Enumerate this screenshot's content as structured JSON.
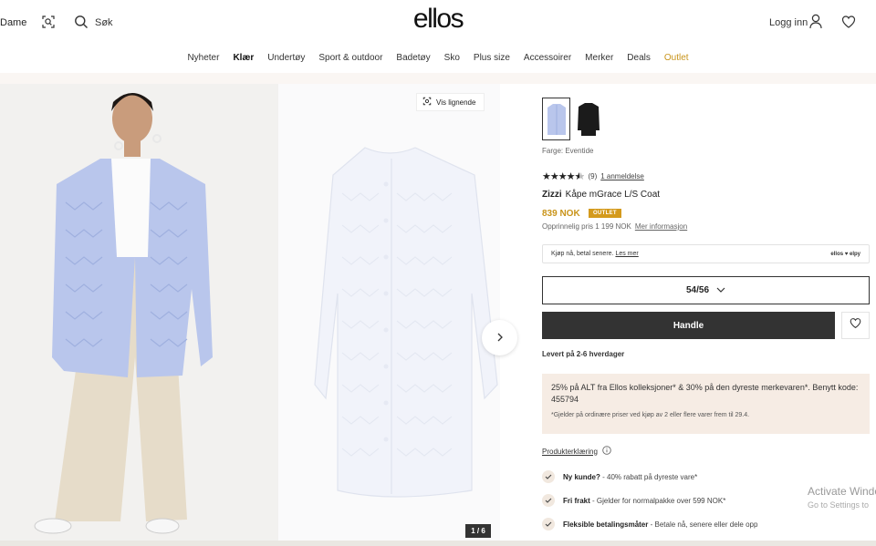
{
  "header": {
    "department": "Dame",
    "search_label": "Søk",
    "logo": "ellos",
    "login_label": "Logg inn",
    "icons": [
      "camera-search-icon",
      "search-icon",
      "user-icon",
      "heart-icon"
    ]
  },
  "nav": {
    "items": [
      {
        "label": "Nyheter"
      },
      {
        "label": "Klær"
      },
      {
        "label": "Undertøy"
      },
      {
        "label": "Sport & outdoor"
      },
      {
        "label": "Badetøy"
      },
      {
        "label": "Sko"
      },
      {
        "label": "Plus size"
      },
      {
        "label": "Accessoirer"
      },
      {
        "label": "Merker"
      },
      {
        "label": "Deals"
      },
      {
        "label": "Outlet"
      }
    ],
    "active": "Klær",
    "outlet_color": "#c9941a"
  },
  "gallery": {
    "similar_label": "Vis lignende",
    "counter": "1 / 6"
  },
  "product": {
    "color_label": "Farge: Eventide",
    "rating": {
      "stars": 4.5,
      "count": "(9)",
      "reviews_link": "1 anmeldelse"
    },
    "brand": "Zizzi",
    "name": "Kåpe mGrace L/S Coat",
    "price": "839 NOK",
    "badge": "OUTLET",
    "original_price": "Opprinnelig pris 1 199 NOK",
    "more_info": "Mer informasjon",
    "swatches": [
      {
        "color": "#b9c6ec",
        "name": "Eventide"
      },
      {
        "color": "#1b1b1b",
        "name": "Black"
      }
    ]
  },
  "klarna": {
    "text": "Kjøp nå, betal senere.",
    "link": "Les mer",
    "brand": "ellos ♥ elpy"
  },
  "purchase": {
    "size": "54/56",
    "buy_label": "Handle",
    "delivery": "Levert på 2-6 hverdager"
  },
  "promo": {
    "text": "25% på ALT fra Ellos kolleksjoner* & 30% på den dyreste merkevaren*. Benytt kode: 455794",
    "note": "*Gjelder på ordinære priser ved kjøp av 2 eller flere varer frem til 29.4."
  },
  "product_declaration": "Produkterklæring",
  "usps": [
    {
      "title": "Ny kunde?",
      "text": " - 40% rabatt på dyreste vare*"
    },
    {
      "title": "Fri frakt",
      "text": " - Gjelder for normalpakke over 599 NOK*"
    },
    {
      "title": "Fleksible betalingsmåter",
      "text": " - Betale nå, senere eller dele opp"
    }
  ],
  "windows_watermark": {
    "line1": "Activate Windo",
    "line2": "Go to Settings to"
  },
  "colors": {
    "accent": "#c9941a",
    "button_dark": "#333333",
    "promo_bg": "#f6ece4",
    "header_band": "#faf6f3"
  }
}
